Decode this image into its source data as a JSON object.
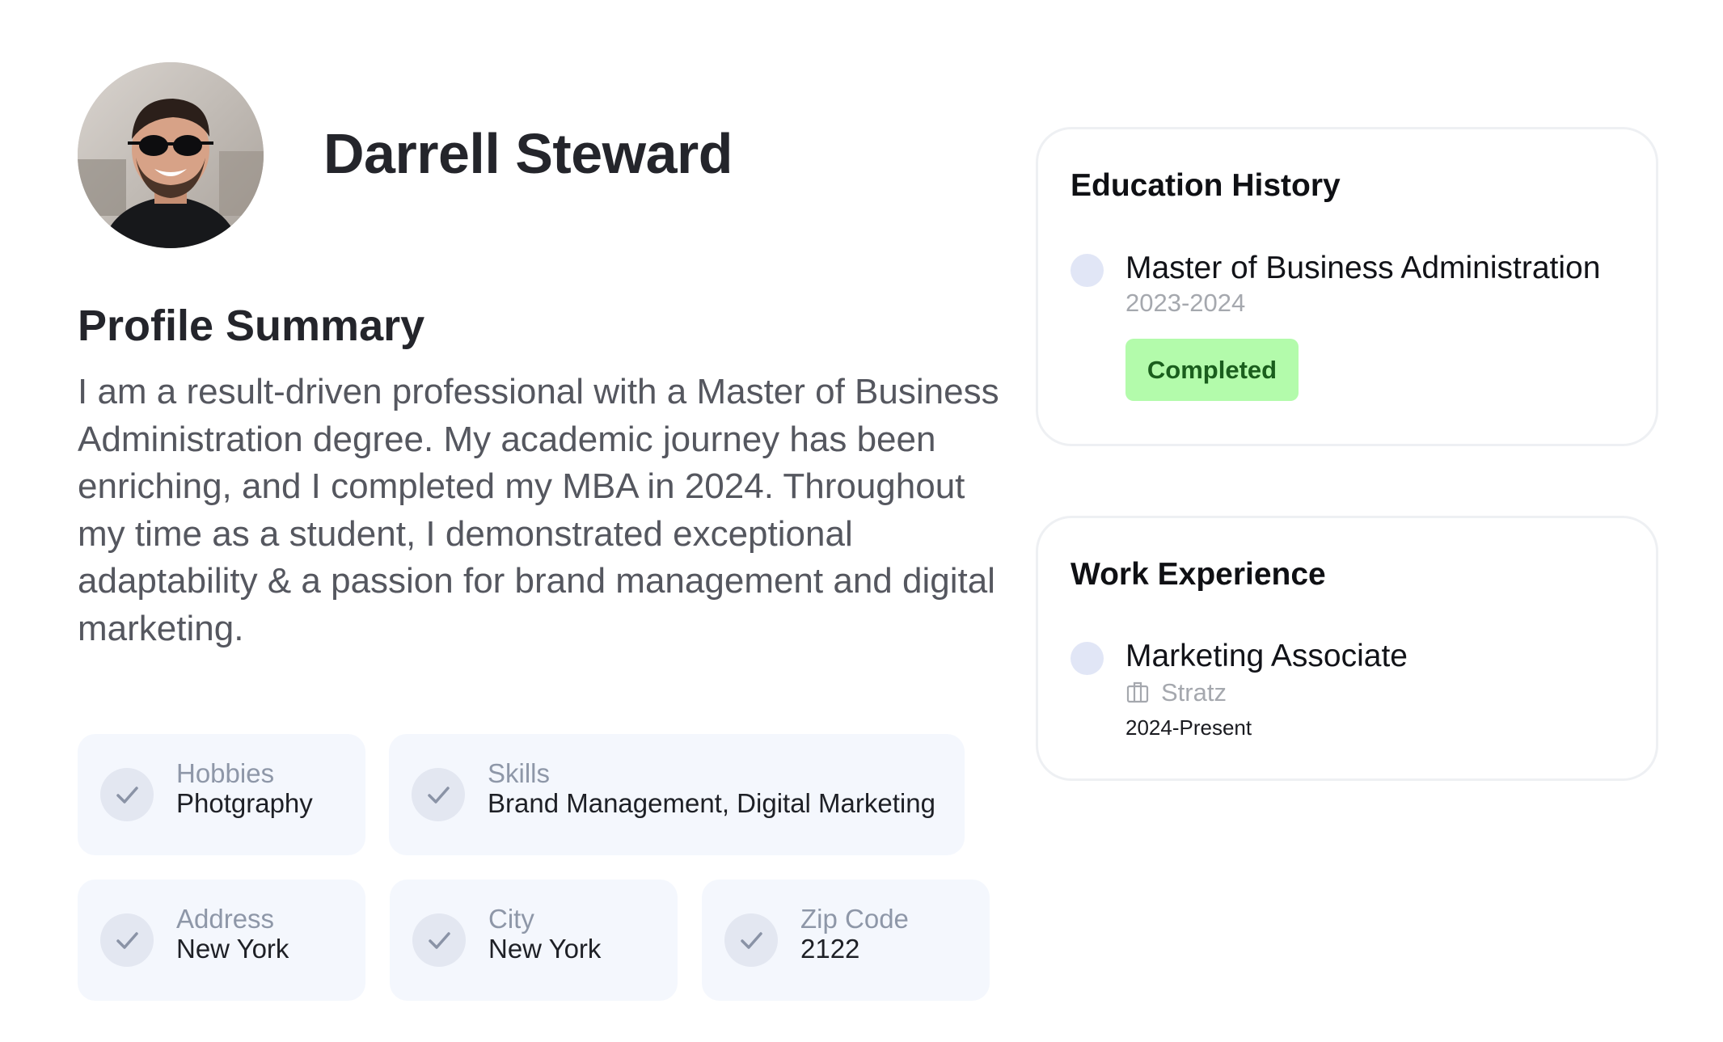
{
  "profile": {
    "name": "Darrell Steward",
    "avatar_icon": "profile-photo"
  },
  "summary": {
    "title": "Profile Summary",
    "text": "I am a result-driven professional with a Master of Business Administration degree. My academic journey has been enriching, and I completed my MBA in 2024. Throughout my time as a student, I demonstrated exceptional adaptability & a passion for brand management and digital marketing."
  },
  "details": [
    {
      "label": "Hobbies",
      "value": "Photgraphy"
    },
    {
      "label": "Skills",
      "value": "Brand Management, Digital Marketing"
    },
    {
      "label": "Address",
      "value": "New York"
    },
    {
      "label": "City",
      "value": "New York"
    },
    {
      "label": "Zip Code",
      "value": "2122"
    }
  ],
  "education": {
    "title": "Education History",
    "items": [
      {
        "degree": "Master of Business Administration",
        "years": "2023-2024",
        "status": "Completed"
      }
    ]
  },
  "work": {
    "title": "Work Experience",
    "items": [
      {
        "role": "Marketing Associate",
        "company": "Stratz",
        "company_icon": "building-icon",
        "period": "2024-Present"
      }
    ]
  },
  "colors": {
    "tile_bg": "#f4f7fd",
    "badge_bg": "#b3fbab",
    "badge_text": "#1a5e1d",
    "timeline_dot": "#e1e6f6"
  }
}
